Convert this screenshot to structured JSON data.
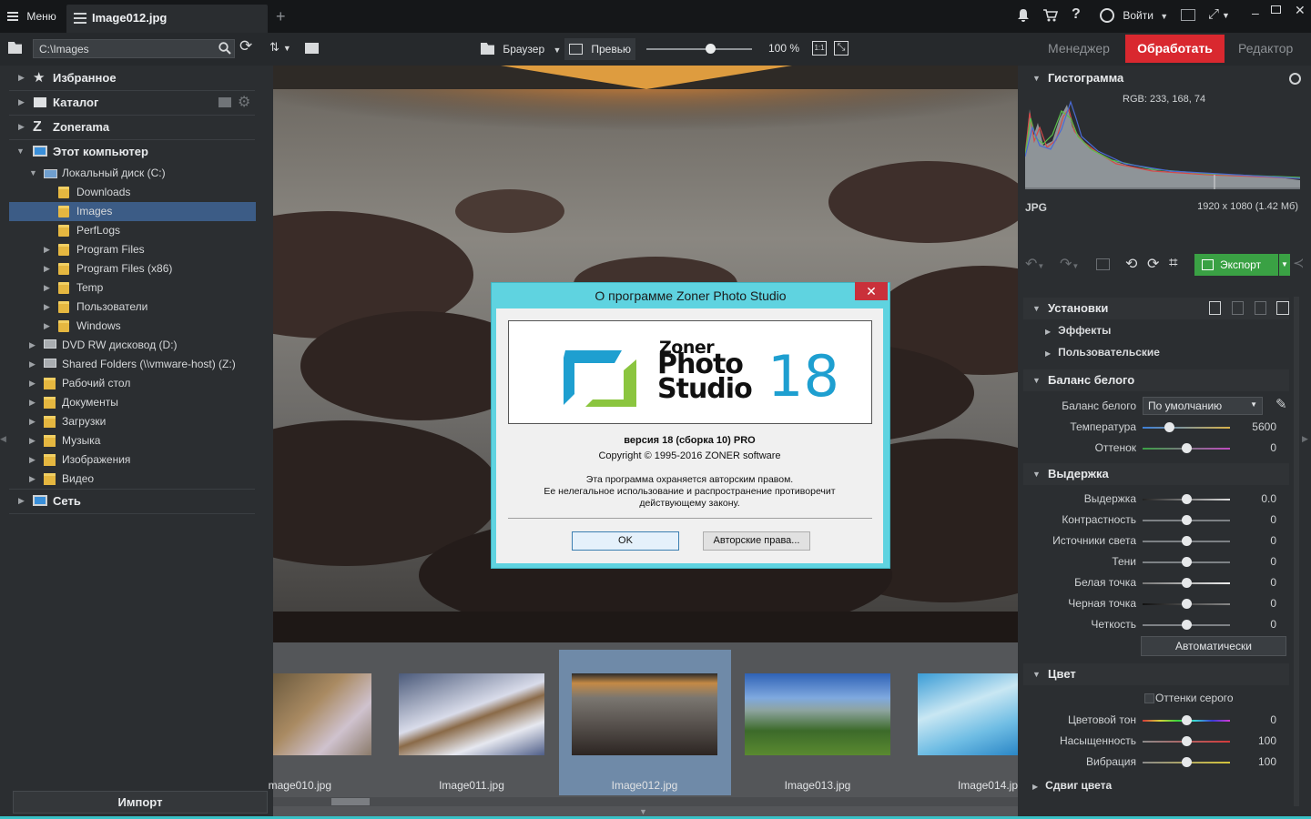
{
  "titlebar": {
    "menu_label": "Меню",
    "tab_title": "Image012.jpg",
    "new_tab_glyph": "+",
    "login_label": "Войти"
  },
  "toolbar": {
    "path_value": "C:\\Images",
    "browser_label": "Браузер",
    "preview_label": "Превью",
    "zoom_value": "100 %",
    "zoom_11": "1:1",
    "mode_manager": "Менеджер",
    "mode_process": "Обработать",
    "mode_editor": "Редактор",
    "slider_fraction": 0.6
  },
  "sidebar": {
    "favorites": "Избранное",
    "catalog": "Каталог",
    "zonerama": "Zonerama",
    "this_pc": "Этот компьютер",
    "local_disk": "Локальный диск (C:)",
    "folders_c": [
      "Downloads",
      "Images",
      "PerfLogs",
      "Program Files",
      "Program Files (x86)",
      "Temp",
      "Пользователи",
      "Windows"
    ],
    "selected_folder": "Images",
    "drives": [
      "DVD RW дисковод (D:)",
      "Shared Folders (\\\\vmware-host) (Z:)",
      "Рабочий стол",
      "Документы",
      "Загрузки",
      "Музыка",
      "Изображения",
      "Видео"
    ],
    "network": "Сеть",
    "import_button": "Импорт"
  },
  "filmstrip": {
    "items": [
      "mage010.jpg",
      "Image011.jpg",
      "Image012.jpg",
      "Image013.jpg",
      "Image014.jp"
    ],
    "selected": "Image012.jpg"
  },
  "dialog": {
    "title": "О программе Zoner Photo Studio",
    "close_glyph": "✕",
    "logo_line1": "Zoner",
    "logo_line2": "Photo",
    "logo_line3": "Studio",
    "logo_number": "18",
    "version": "версия 18 (сборка 10) PRO",
    "copyright": "Copyright © 1995-2016 ZONER software",
    "notice_line1": "Эта программа охраняется авторским правом.",
    "notice_line2": "Ее нелегальное использование и распространение противоречит",
    "notice_line3": "действующему закону.",
    "ok_button": "OK",
    "rights_button": "Авторские права..."
  },
  "right_panel": {
    "histogram_title": "Гистограмма",
    "rgb_readout": "RGB: 233, 168, 74",
    "format": "JPG",
    "dimensions": "1920 x 1080 (1.42 Мб)",
    "export_button": "Экспорт",
    "settings_title": "Установки",
    "effects_label": "Эффекты",
    "custom_label": "Пользовательские",
    "wb_title": "Баланс белого",
    "wb_label": "Баланс белого",
    "wb_select": "По умолчанию",
    "wb_sliders": [
      {
        "label": "Температура",
        "value": "5600",
        "pos": 0.3
      },
      {
        "label": "Оттенок",
        "value": "0",
        "pos": 0.5
      }
    ],
    "exposure_title": "Выдержка",
    "exposure_sliders": [
      {
        "label": "Выдержка",
        "value": "0.0",
        "pos": 0.5
      },
      {
        "label": "Контрастность",
        "value": "0",
        "pos": 0.5
      },
      {
        "label": "Источники света",
        "value": "0",
        "pos": 0.5
      },
      {
        "label": "Тени",
        "value": "0",
        "pos": 0.5
      },
      {
        "label": "Белая точка",
        "value": "0",
        "pos": 0.5
      },
      {
        "label": "Черная точка",
        "value": "0",
        "pos": 0.5
      },
      {
        "label": "Четкость",
        "value": "0",
        "pos": 0.5
      }
    ],
    "auto_button": "Автоматически",
    "color_title": "Цвет",
    "grayscale_label": "Оттенки серого",
    "color_sliders": [
      {
        "label": "Цветовой тон",
        "value": "0",
        "pos": 0.5
      },
      {
        "label": "Насыщенность",
        "value": "100",
        "pos": 0.5
      },
      {
        "label": "Вибрация",
        "value": "100",
        "pos": 0.5
      }
    ],
    "shift_title": "Сдвиг цвета"
  }
}
